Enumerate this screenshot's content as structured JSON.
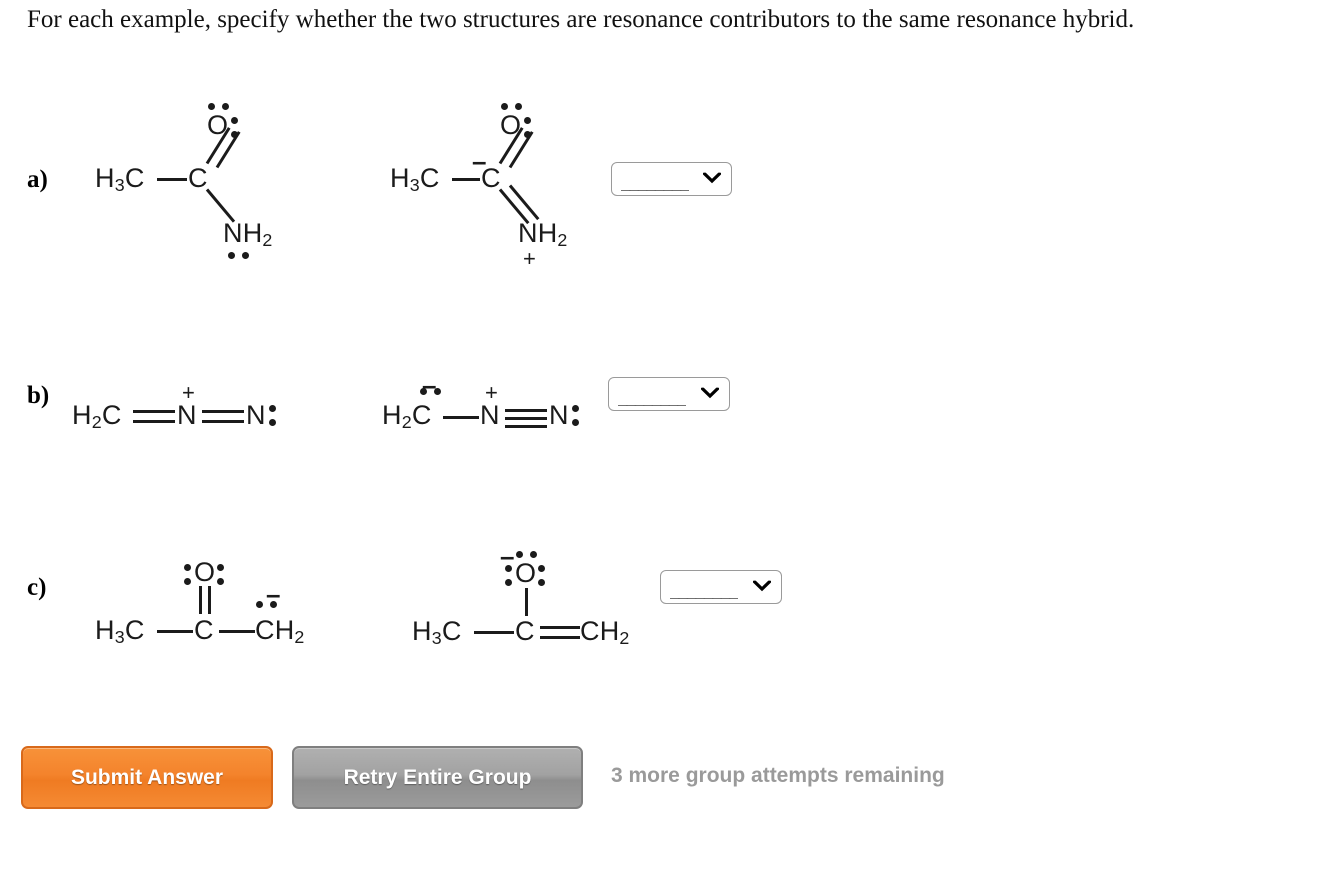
{
  "prompt": {
    "text": "For each example, specify whether the two structures are resonance contributors to the same resonance hybrid."
  },
  "rows": [
    {
      "label": "a)",
      "left_structure": {
        "name": "acetamide-neutral",
        "formula": "H3C-C(=O)-NH2",
        "atoms": [
          "H",
          "3",
          "C",
          "C",
          "O",
          "N",
          "H",
          "2"
        ],
        "labels": {
          "methyl": "H3C",
          "carbonyl_carbon": "C",
          "oxygen": "O",
          "amine": "NH2"
        },
        "charges": [],
        "lone_pairs": "O: two pairs (top, right); N: one pair (bottom)"
      },
      "right_structure": {
        "name": "acetamide-carbanion-iminium",
        "formula": "H3C-C(-)(=O)=NH2(+)",
        "labels": {
          "methyl": "H3C",
          "carbonyl_carbon": "C",
          "oxygen": "O",
          "amine": "NH2"
        },
        "charges": [
          {
            "atom": "C",
            "sign": "–"
          },
          {
            "atom": "NH2",
            "sign": "+"
          }
        ],
        "lone_pairs": "O: two pairs (top, right)"
      },
      "dropdown": {
        "name": "answer-select-a",
        "value": "",
        "placeholder": "",
        "icon": "chevron-down-icon"
      }
    },
    {
      "label": "b)",
      "left_structure": {
        "name": "diazomethane-allene-form",
        "formula": "H2C=N(+)=N:",
        "labels": {
          "carbon": "H2C",
          "center_nitrogen": "N",
          "terminal_nitrogen": "N"
        },
        "charges": [
          {
            "atom": "N-center",
            "sign": "+"
          }
        ],
        "lone_pairs": "terminal N: one pair (right)"
      },
      "right_structure": {
        "name": "diazomethane-carbanion-form",
        "formula": "H2C(-)-N(+)≡N:",
        "labels": {
          "carbon": "H2C",
          "center_nitrogen": "N",
          "terminal_nitrogen": "N"
        },
        "charges": [
          {
            "atom": "C",
            "sign": "–"
          },
          {
            "atom": "N-center",
            "sign": "+"
          }
        ],
        "lone_pairs": "C: one pair (top); terminal N: one pair (right)"
      },
      "dropdown": {
        "name": "answer-select-b",
        "value": "",
        "placeholder": "",
        "icon": "chevron-down-icon"
      }
    },
    {
      "label": "c)",
      "left_structure": {
        "name": "acetone-enolate-carbanion-form",
        "formula": "H3C-C(=O)-CH2(-)",
        "labels": {
          "methyl": "H3C",
          "carbonyl_carbon": "C",
          "oxygen": "O",
          "methylene": "CH2"
        },
        "charges": [
          {
            "atom": "CH2",
            "sign": "–"
          }
        ],
        "lone_pairs": "O: two pairs (left, right); CH2: one pair (top)"
      },
      "right_structure": {
        "name": "acetone-enolate-enolate-form",
        "formula": "H3C-C(-O(-))=CH2",
        "labels": {
          "methyl": "H3C",
          "central_carbon": "C",
          "oxygen": "O",
          "methylene": "CH2"
        },
        "charges": [
          {
            "atom": "O",
            "sign": "–"
          }
        ],
        "lone_pairs": "O: three pairs (top, left, right)"
      },
      "dropdown": {
        "name": "answer-select-c",
        "value": "",
        "placeholder": "",
        "icon": "chevron-down-icon"
      }
    }
  ],
  "footer": {
    "submit_label": "Submit Answer",
    "retry_label": "Retry Entire Group",
    "attempts_text": "3 more group attempts remaining",
    "submit_color": "#f4832c",
    "retry_color": "#9b9b9b",
    "attempts_color": "#9a9a9a"
  }
}
